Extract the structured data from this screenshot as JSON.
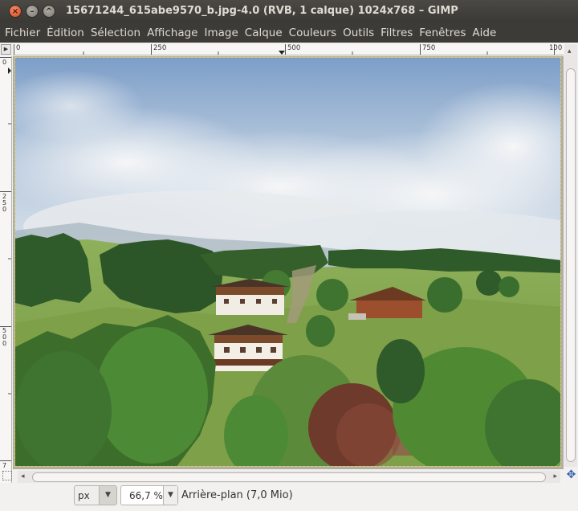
{
  "window": {
    "title": "15671244_615abe9570_b.jpg-4.0 (RVB, 1 calque) 1024x768 – GIMP"
  },
  "menu": [
    "Fichier",
    "Édition",
    "Sélection",
    "Affichage",
    "Image",
    "Calque",
    "Couleurs",
    "Outils",
    "Filtres",
    "Fenêtres",
    "Aide"
  ],
  "rulers": {
    "horizontal": [
      "0",
      "250",
      "500",
      "750",
      "100"
    ],
    "vertical": [
      "0",
      "250",
      "500",
      "7"
    ]
  },
  "status": {
    "unit": "px",
    "zoom": "66,7 %",
    "layer": "Arrière-plan (7,0 Mio)"
  },
  "icons": {
    "close": "close-icon",
    "minimize": "minimize-icon",
    "maximize": "maximize-icon",
    "navigate": "navigate-icon",
    "menu_arrow": "triangle-right-icon"
  }
}
